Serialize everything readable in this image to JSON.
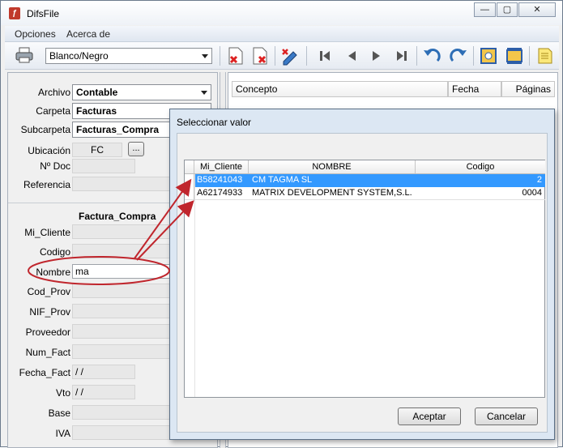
{
  "window": {
    "title": "DifsFile",
    "controls": {
      "minimize": "—",
      "maximize": "▢",
      "close": "✕"
    }
  },
  "menu": {
    "items": [
      "Opciones",
      "Acerca de"
    ]
  },
  "toolbar": {
    "color_mode": "Blanco/Negro"
  },
  "form": {
    "archivo_label": "Archivo",
    "archivo_value": "Contable",
    "carpeta_label": "Carpeta",
    "carpeta_value": "Facturas",
    "subcarpeta_label": "Subcarpeta",
    "subcarpeta_value": "Facturas_Compra",
    "ubicacion_label": "Ubicación",
    "ubicacion_value": "FC",
    "browse_label": "...",
    "ndoc_label": "Nº Doc",
    "referencia_label": "Referencia",
    "section_title": "Factura_Compra",
    "fields": [
      "Mi_Cliente",
      "Codigo",
      "Nombre",
      "Cod_Prov",
      "NIF_Prov",
      "Proveedor",
      "Num_Fact",
      "Fecha_Fact",
      "Vto",
      "Base",
      "IVA"
    ],
    "nombre_value": "ma",
    "fecha_fact_value": " /  /",
    "vto_value": " /  /"
  },
  "documents": {
    "columns": [
      "Concepto",
      "Fecha",
      "Páginas"
    ]
  },
  "dialog": {
    "title": "Seleccionar valor",
    "columns": [
      "Mi_Cliente",
      "NOMBRE",
      "Codigo"
    ],
    "rows": [
      {
        "mi_cliente": "B58241043",
        "nombre": "CM TAGMA SL",
        "codigo": "2",
        "selected": true
      },
      {
        "mi_cliente": "A62174933",
        "nombre": "MATRIX DEVELOPMENT SYSTEM,S.L.",
        "codigo": "0004",
        "selected": false
      }
    ],
    "accept_label": "Aceptar",
    "cancel_label": "Cancelar"
  },
  "colors": {
    "selection": "#3399ff",
    "annotation": "#c0262d"
  }
}
